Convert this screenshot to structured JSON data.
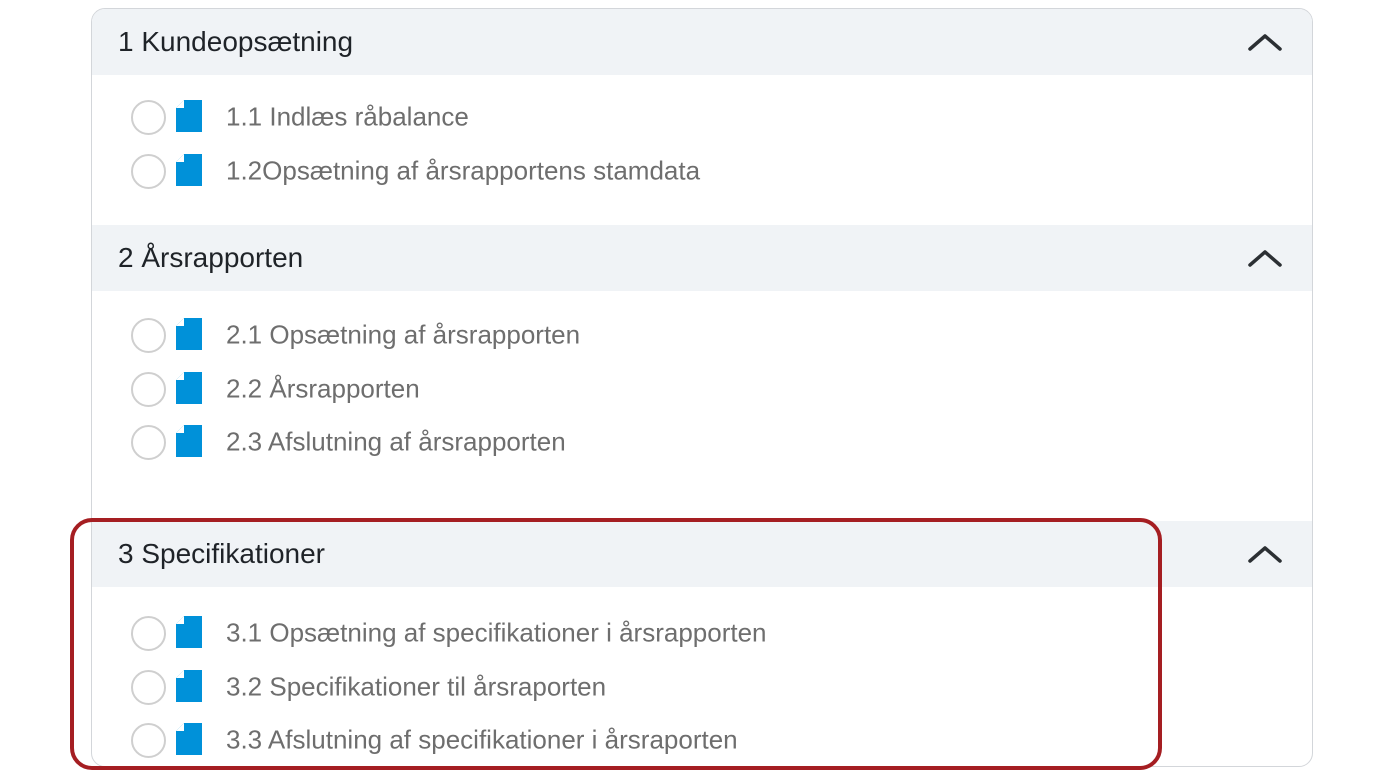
{
  "sections": [
    {
      "title": "1 Kundeopsætning",
      "toggle_icon": "chevron-up-icon",
      "tasks": [
        {
          "label": "1.1 Indlæs råbalance",
          "status_icon": "empty-circle-icon",
          "type_icon": "document-icon"
        },
        {
          "label": "1.2Opsætning af årsrapportens stamdata",
          "status_icon": "empty-circle-icon",
          "type_icon": "document-icon"
        }
      ]
    },
    {
      "title": "2 Årsrapporten",
      "toggle_icon": "chevron-up-icon",
      "tasks": [
        {
          "label": "2.1 Opsætning af årsrapporten",
          "status_icon": "empty-circle-icon",
          "type_icon": "document-icon"
        },
        {
          "label": "2.2 Årsrapporten",
          "status_icon": "empty-circle-icon",
          "type_icon": "document-icon"
        },
        {
          "label": "2.3 Afslutning af årsrapporten",
          "status_icon": "empty-circle-icon",
          "type_icon": "document-icon"
        }
      ]
    },
    {
      "title": "3 Specifikationer",
      "toggle_icon": "chevron-up-icon",
      "highlighted": true,
      "tasks": [
        {
          "label": "3.1 Opsætning af specifikationer i årsrapporten",
          "status_icon": "empty-circle-icon",
          "type_icon": "document-icon"
        },
        {
          "label": "3.2 Specifikationer til årsraporten",
          "status_icon": "empty-circle-icon",
          "type_icon": "document-icon"
        },
        {
          "label": "3.3 Afslutning af specifikationer i årsraporten",
          "status_icon": "empty-circle-icon",
          "type_icon": "document-icon"
        }
      ]
    }
  ],
  "colors": {
    "header_background": "#f0f3f6",
    "document_icon": "#0091d9",
    "highlight_border": "#a51e22",
    "task_text": "#6e6e6e",
    "title_text": "#1f2328"
  }
}
